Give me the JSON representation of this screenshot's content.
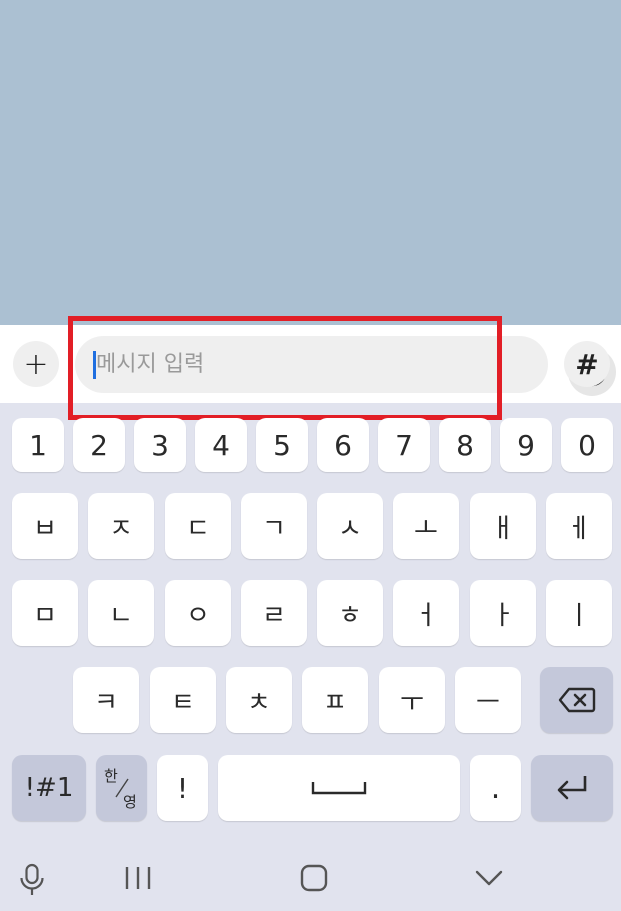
{
  "input_bar": {
    "add_icon": "+",
    "placeholder": "메시지 입력",
    "emoji_icon": "smiley-face-icon",
    "hashtag_icon": "#"
  },
  "keyboard": {
    "numbers": [
      "1",
      "2",
      "3",
      "4",
      "5",
      "6",
      "7",
      "8",
      "9",
      "0"
    ],
    "row2": [
      "ㅂ",
      "ㅈ",
      "ㄷ",
      "ㄱ",
      "ㅅ",
      "ㅗ",
      "ㅐ",
      "ㅔ"
    ],
    "row3": [
      "ㅁ",
      "ㄴ",
      "ㅇ",
      "ㄹ",
      "ㅎ",
      "ㅓ",
      "ㅏ",
      "ㅣ"
    ],
    "row4": [
      "ㅋ",
      "ㅌ",
      "ㅊ",
      "ㅍ",
      "ㅜ",
      "ㅡ"
    ],
    "symbols_label": "!#1",
    "lang_top": "한",
    "lang_bottom": "영",
    "exclamation": "!",
    "period": "."
  },
  "colors": {
    "chat_background": "#abc0d2",
    "keyboard_background": "#e1e3ee",
    "highlight": "#e21e26",
    "caret": "#1f6fe0"
  }
}
